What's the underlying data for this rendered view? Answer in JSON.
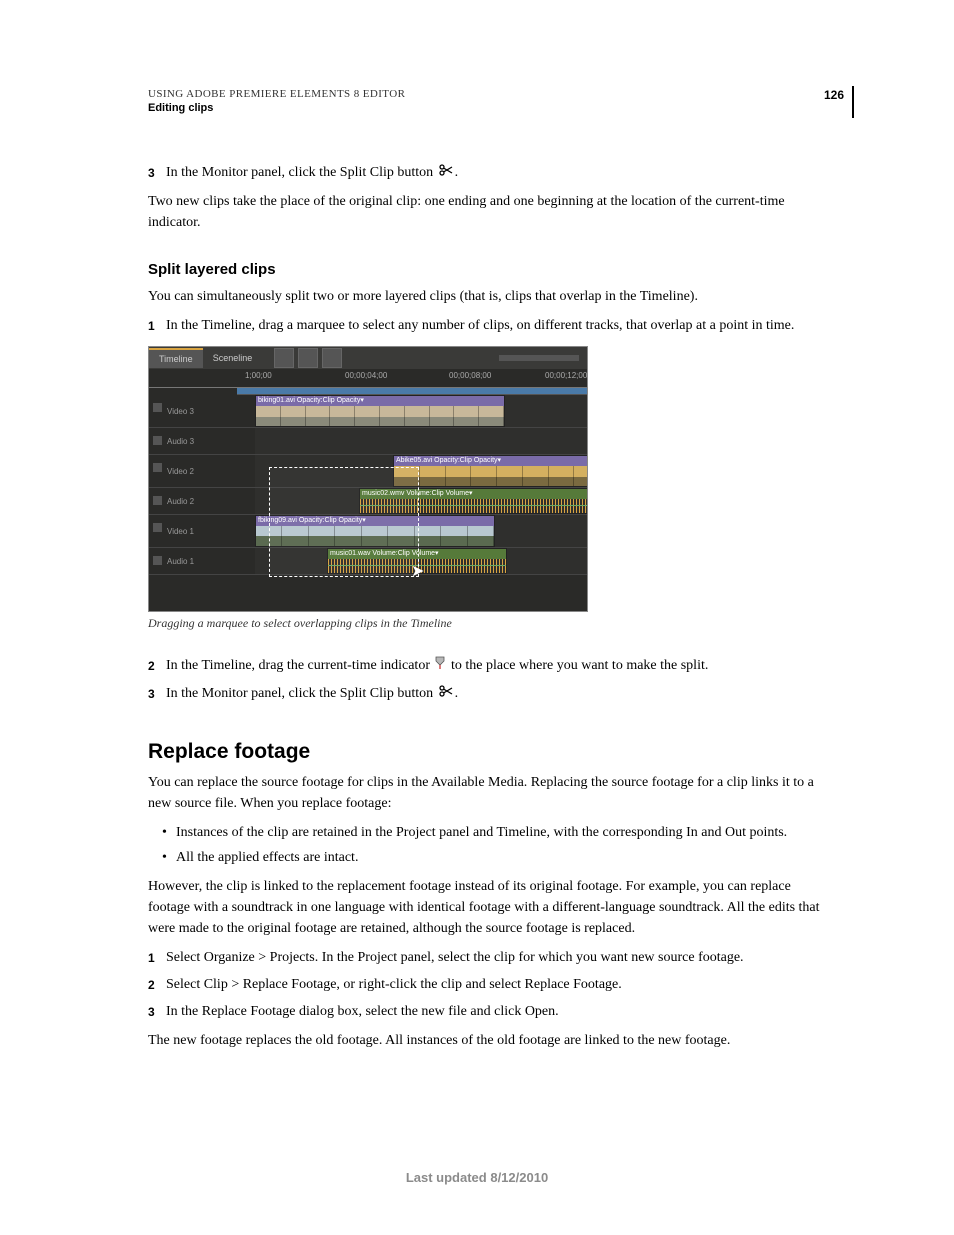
{
  "header": {
    "line1": "USING ADOBE PREMIERE ELEMENTS 8 EDITOR",
    "line2": "Editing clips",
    "page": "126"
  },
  "step3a": {
    "num": "3",
    "text_a": "In the Monitor panel, click the Split Clip button ",
    "text_b": "."
  },
  "para1": "Two new clips take the place of the original clip: one ending and one beginning at the location of the current-time indicator.",
  "h3": "Split layered clips",
  "para2": "You can simultaneously split two or more layered clips (that is, clips that overlap in the Timeline).",
  "step1": {
    "num": "1",
    "text": "In the Timeline, drag a marquee to select any number of clips, on different tracks, that overlap at a point in time."
  },
  "fig": {
    "tabs": {
      "timeline": "Timeline",
      "sceneline": "Sceneline"
    },
    "ruler": {
      "t1": "1;00;00",
      "t2": "00;00;04;00",
      "t3": "00;00;08;00",
      "t4": "00;00;12;00"
    },
    "tracks": {
      "v3": "Video 3",
      "a3": "Audio 3",
      "v2": "Video 2",
      "a2": "Audio 2",
      "v1": "Video 1",
      "a1": "Audio 1"
    },
    "clips": {
      "c1": "biking01.avi Opacity:Clip Opacity▾",
      "c2": "Abike05.avi Opacity:Clip Opacity▾",
      "c3": "music02.wmv Volume:Clip Volume▾",
      "c4": "fbiking09.avi Opacity:Clip Opacity▾",
      "c5": "music01.wav Volume:Clip Volume▾"
    }
  },
  "caption": "Dragging a marquee to select overlapping clips in the Timeline",
  "step2": {
    "num": "2",
    "text_a": "In the Timeline, drag the current-time indicator ",
    "text_b": " to the place where you want to make the split."
  },
  "step3b": {
    "num": "3",
    "text_a": "In the Monitor panel, click the Split Clip button ",
    "text_b": "."
  },
  "h2": "Replace footage",
  "para3": "You can replace the source footage for clips in the Available Media. Replacing the source footage for a clip links it to a new source file. When you replace footage:",
  "b1": "Instances of the clip are retained in the Project panel and Timeline, with the corresponding In and Out points.",
  "b2": "All the applied effects are intact.",
  "para4": "However, the clip is linked to the replacement footage instead of its original footage. For example, you can replace footage with a soundtrack in one language with identical footage with a different-language soundtrack. All the edits that were made to the original footage are retained, although the source footage is replaced.",
  "s1": {
    "num": "1",
    "text": "Select Organize > Projects. In the Project panel, select the clip for which you want new source footage."
  },
  "s2": {
    "num": "2",
    "text": "Select Clip > Replace Footage, or right-click the clip and select Replace Footage."
  },
  "s3": {
    "num": "3",
    "text": "In the Replace Footage dialog box, select the new file and click Open."
  },
  "para5": "The new footage replaces the old footage. All instances of the old footage are linked to the new footage.",
  "footer": "Last updated 8/12/2010"
}
